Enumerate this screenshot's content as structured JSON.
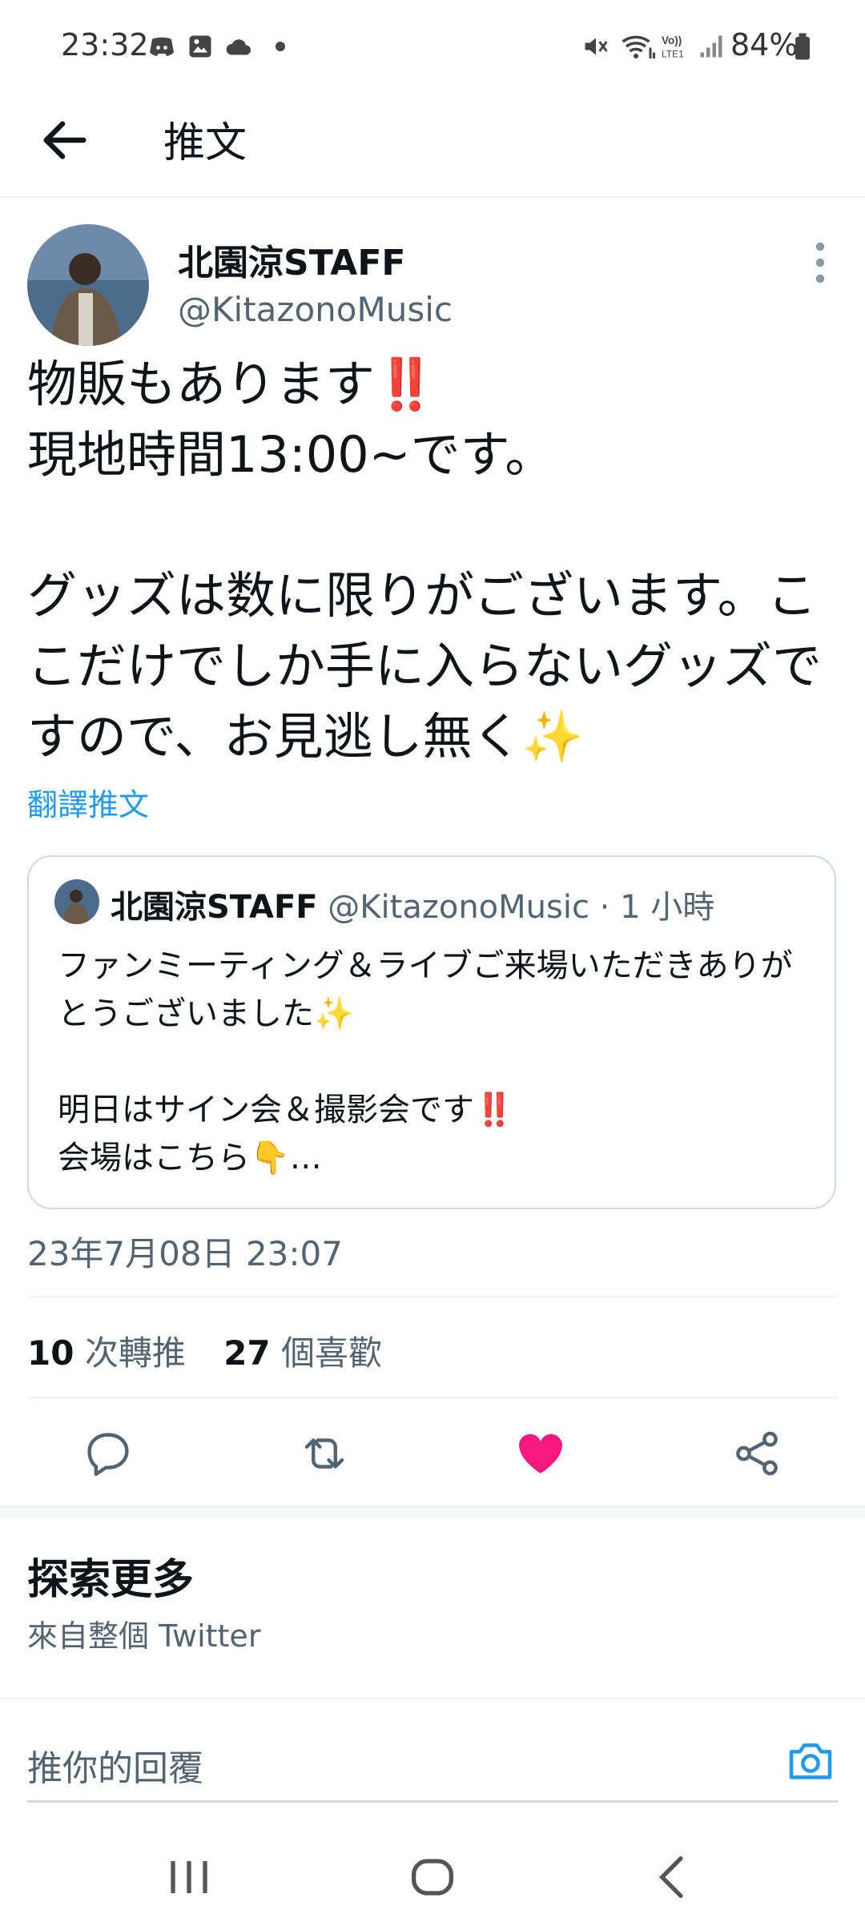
{
  "status_bar": {
    "time": "23:32",
    "battery": "84%",
    "left_icons": [
      "discord-icon",
      "gallery-icon",
      "cloud-icon",
      "dot-icon"
    ],
    "right_icons": [
      "mute-icon",
      "wifi-icon",
      "volte-icon",
      "signal-icon",
      "battery-icon"
    ]
  },
  "header": {
    "title": "推文"
  },
  "tweet": {
    "author_name": "北園涼STAFF",
    "author_handle": "@KitazonoMusic",
    "text": "物販もあります‼️\n現地時間13:00~です。\n\nグッズは数に限りがございます。ここだけでしか手に入らないグッズですので、お見逃し無く✨",
    "translate": "翻譯推文",
    "timestamp": "23年7月08日 23:07",
    "retweets": "10",
    "retweets_label": "次轉推",
    "likes": "27",
    "likes_label": "個喜歡"
  },
  "quote": {
    "author_name": "北園涼STAFF",
    "meta": " @KitazonoMusic · 1 小時",
    "text": "ファンミーティング＆ライブご来場いただきありがとうございました✨\n\n明日はサイン会＆撮影会です‼️\n会場はこちら👇…"
  },
  "explore": {
    "title": "探索更多",
    "subtitle": "來自整個 Twitter"
  },
  "reply": {
    "placeholder": "推你的回覆"
  },
  "colors": {
    "accent": "#1d9bf0",
    "like": "#f91880",
    "text": "#0f1419",
    "secondary": "#536471"
  }
}
